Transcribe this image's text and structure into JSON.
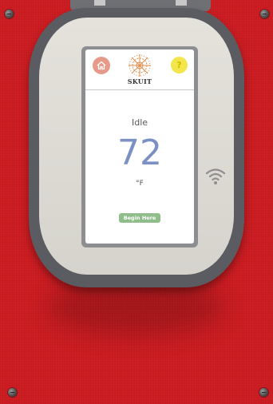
{
  "colors": {
    "panel_red": "#c81a1f",
    "home_button": "#e89a8a",
    "help_button": "#f3e64b",
    "temperature": "#7c90c4",
    "begin_button": "#8fbe8a"
  },
  "thermostat": {
    "brand": "SKUIT",
    "header": {
      "home_icon": "home-icon",
      "help_icon": "question-icon",
      "help_glyph": "?"
    },
    "status": "Idle",
    "temperature": "72",
    "unit": "°F",
    "begin_button_label": "Begin Here"
  },
  "device": {
    "wifi_icon": "wifi-icon"
  }
}
